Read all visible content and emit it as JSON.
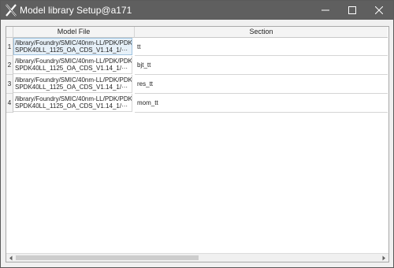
{
  "window": {
    "title": "Model library Setup@a171",
    "icon": "x-app-icon",
    "controls": [
      "minimize-icon",
      "maximize-icon",
      "close-icon"
    ]
  },
  "table": {
    "headers": [
      "Model File",
      "Section"
    ],
    "rows": [
      {
        "num": "1",
        "file_line1": "/library/Foundry/SMIC/40nm-LL/PDK/PDK/",
        "file_line2": "SPDK40LL_1125_OA_CDS_V1.14_1/···",
        "section": "tt"
      },
      {
        "num": "2",
        "file_line1": "/library/Foundry/SMIC/40nm-LL/PDK/PDK/",
        "file_line2": "SPDK40LL_1125_OA_CDS_V1.14_1/···",
        "section": "bjt_tt"
      },
      {
        "num": "3",
        "file_line1": "/library/Foundry/SMIC/40nm-LL/PDK/PDK/",
        "file_line2": "SPDK40LL_1125_OA_CDS_V1.14_1/···",
        "section": "res_tt"
      },
      {
        "num": "4",
        "file_line1": "/library/Foundry/SMIC/40nm-LL/PDK/PDK/",
        "file_line2": "SPDK40LL_1125_OA_CDS_V1.14_1/···",
        "section": "mom_tt"
      }
    ],
    "selected_row": "1"
  },
  "scrollbar": {
    "left_icon": "scroll-left-icon",
    "right_icon": "scroll-right-icon"
  },
  "colors": {
    "titlebar": "#5f5f5f",
    "selection": "#e6f0f8"
  }
}
